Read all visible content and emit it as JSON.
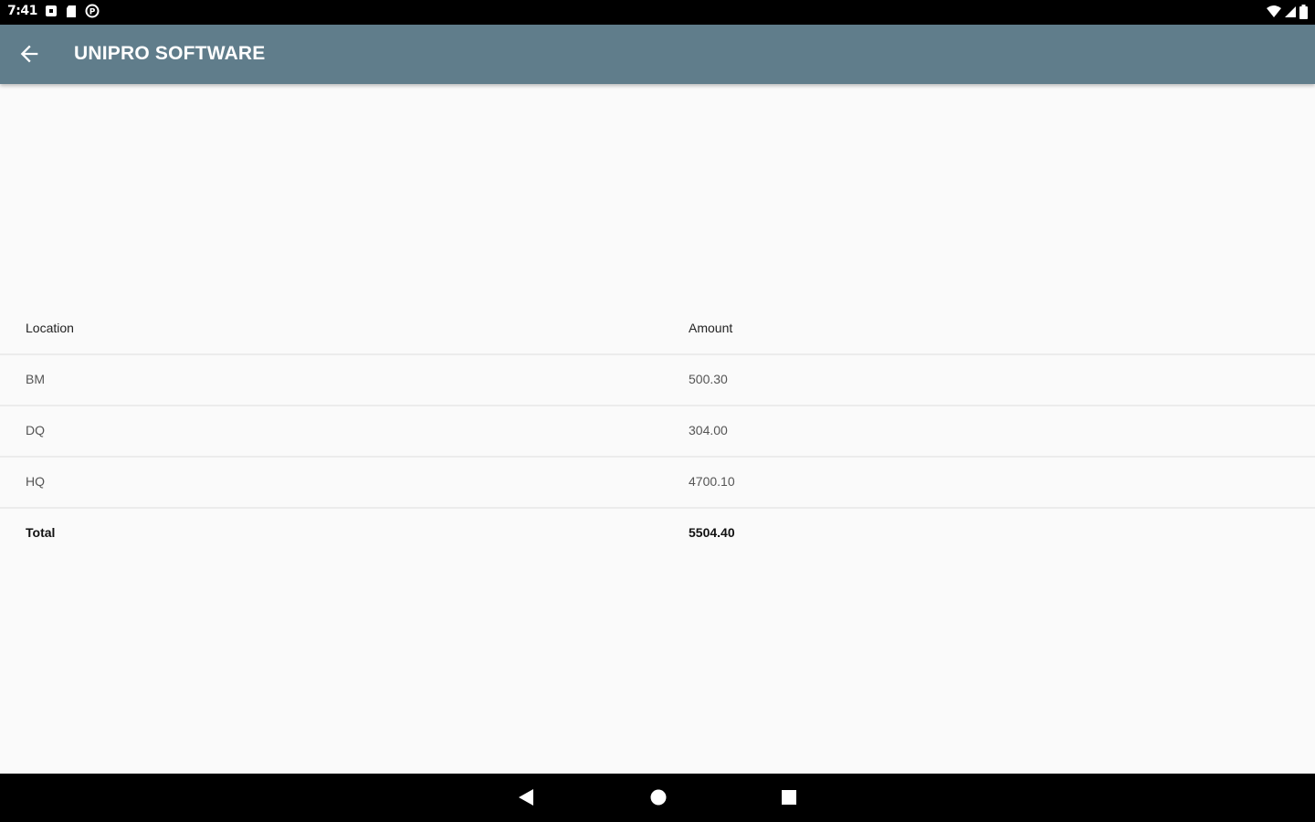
{
  "status_bar": {
    "time": "7:41",
    "left_icons": [
      "notification-square-icon",
      "sd-card-icon",
      "circle-p-icon"
    ],
    "right_icons": [
      "wifi-icon",
      "signal-icon",
      "battery-icon"
    ]
  },
  "app_bar": {
    "title": "UNIPRO SOFTWARE",
    "back_icon": "arrow-left-icon",
    "background": "#607d8b"
  },
  "table": {
    "headers": {
      "location": "Location",
      "amount": "Amount"
    },
    "rows": [
      {
        "location": "BM",
        "amount": "500.30"
      },
      {
        "location": "DQ",
        "amount": "304.00"
      },
      {
        "location": "HQ",
        "amount": "4700.10"
      }
    ],
    "total": {
      "label": "Total",
      "amount": "5504.40"
    }
  },
  "nav_bar": {
    "buttons": [
      "back-triangle-icon",
      "home-circle-icon",
      "recents-square-icon"
    ]
  }
}
